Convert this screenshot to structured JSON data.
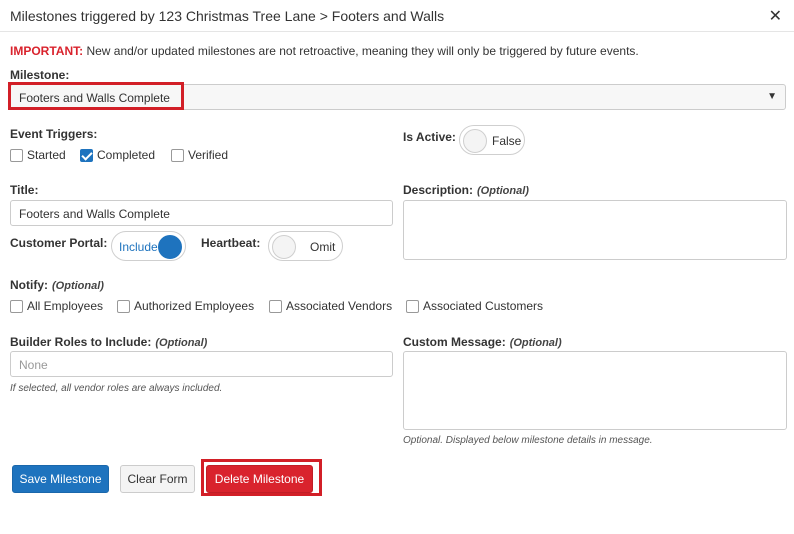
{
  "dialog": {
    "title": "Milestones triggered by 123 Christmas Tree Lane > Footers and Walls",
    "close_glyph": "✕"
  },
  "notice": {
    "important_label": "IMPORTANT:",
    "text": " New and/or updated milestones are not retroactive, meaning they will only be triggered by future events."
  },
  "milestone": {
    "label": "Milestone:",
    "selected_value": "Footers and Walls Complete",
    "arrow": "▼"
  },
  "event_triggers": {
    "label": "Event Triggers:",
    "options": [
      {
        "label": "Started",
        "checked": false
      },
      {
        "label": "Completed",
        "checked": true
      },
      {
        "label": "Verified",
        "checked": false
      }
    ]
  },
  "is_active": {
    "label": "Is Active:",
    "value": "False"
  },
  "title_field": {
    "label": "Title:",
    "value": "Footers and Walls Complete"
  },
  "description": {
    "label": "Description:",
    "optional": "(Optional)",
    "value": ""
  },
  "customer_portal": {
    "label": "Customer Portal:",
    "value": "Include"
  },
  "heartbeat": {
    "label": "Heartbeat:",
    "value": "Omit"
  },
  "notify": {
    "label": "Notify:",
    "optional": "(Optional)",
    "options": [
      {
        "label": "All Employees",
        "checked": false
      },
      {
        "label": "Authorized Employees",
        "checked": false
      },
      {
        "label": "Associated Vendors",
        "checked": false
      },
      {
        "label": "Associated Customers",
        "checked": false
      }
    ]
  },
  "builder_roles": {
    "label": "Builder Roles to Include:",
    "optional": "(Optional)",
    "placeholder": "None",
    "help": "If selected, all vendor roles are always included."
  },
  "custom_message": {
    "label": "Custom Message:",
    "optional": "(Optional)",
    "value": "",
    "help": "Optional. Displayed below milestone details in message."
  },
  "buttons": {
    "save": "Save Milestone",
    "clear": "Clear Form",
    "delete": "Delete Milestone"
  },
  "colors": {
    "primary": "#1e73be",
    "danger": "#d9232d",
    "highlight": "#d21f27"
  }
}
